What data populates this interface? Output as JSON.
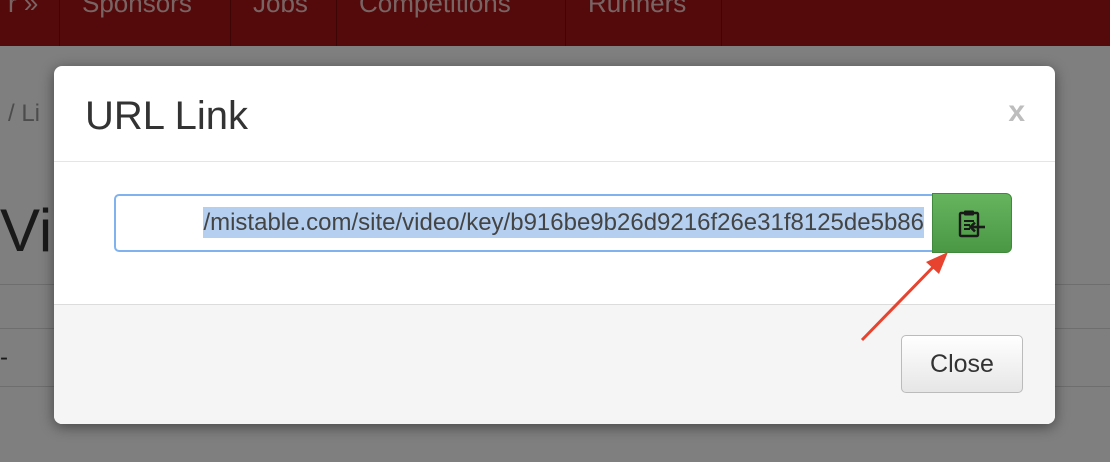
{
  "background": {
    "nav_items": [
      "r »",
      "Sponsors",
      "Jobs",
      "Competitions",
      "Runners"
    ],
    "breadcrumb_text": "/ Li",
    "heading_text": "Vi",
    "dash_text": "-",
    "nav_color": "#a81314"
  },
  "modal": {
    "title": "URL Link",
    "close_x": "x",
    "url_value": "/mistable.com/site/video/key/b916be9b26d9216f26e31f8125de5b86",
    "url_prefix": "/",
    "url_text": "/mistable.com/site/video/key/b916be9b26d9216f26e31f8125de5b86",
    "copy_button_icon": "clipboard-paste-icon",
    "copy_button_color": "#5aa852",
    "close_button_label": "Close"
  },
  "annotation": {
    "arrow_color": "#e8432f",
    "arrow_icon": "red-arrow-pointer"
  }
}
